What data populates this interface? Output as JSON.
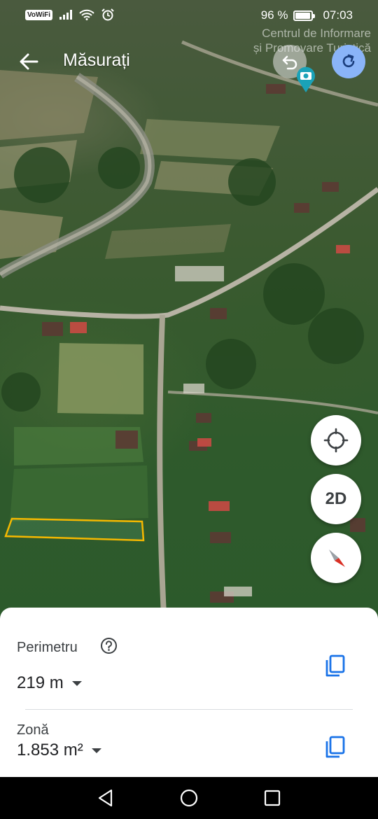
{
  "status_bar": {
    "carrier_badge": "VoWiFi",
    "battery_text": "96 %",
    "battery_level": 0.96,
    "time": "07:03",
    "icons": [
      "signal-icon",
      "wifi-icon",
      "alarm-icon",
      "battery-icon"
    ]
  },
  "app_bar": {
    "title": "Măsurați",
    "back_icon": "arrow-back-icon",
    "undo_icon": "undo-icon",
    "redo_icon": "redo-icon"
  },
  "map": {
    "attribution_line1": "Centrul de Informare",
    "attribution_line2": "și Promovare Turistică",
    "photo_pin_icon": "camera-pin-icon",
    "measured_outline_color": "#f5b800"
  },
  "controls": {
    "location_icon": "my-location-icon",
    "view_mode_label": "2D",
    "compass_icon": "compass-icon"
  },
  "sheet": {
    "perimeter_label": "Perimetru",
    "perimeter_value": "219 m",
    "area_label": "Zonă",
    "area_value": "1.853 m²",
    "help_icon": "help-icon",
    "copy_icon": "copy-icon",
    "accent_color": "#1a73e8"
  },
  "nav_bar": {
    "icons": [
      "back-triangle-icon",
      "home-circle-icon",
      "recents-square-icon"
    ]
  }
}
